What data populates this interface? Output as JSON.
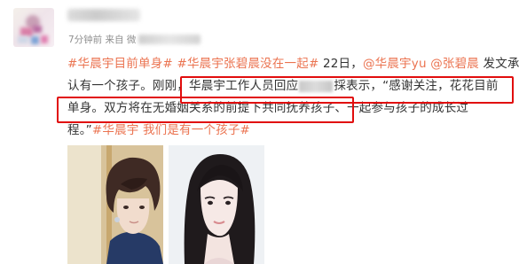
{
  "post": {
    "meta_time": "7分钟前 来自 微",
    "line1": [
      {
        "t": "#华晨宇目前单身#",
        "link": true
      },
      {
        "t": " ",
        "link": false
      },
      {
        "t": "#华晨宇张碧晨没在一起#",
        "link": true
      },
      {
        "t": " 22日，",
        "link": false
      },
      {
        "t": "@华晨宇yu",
        "link": true
      },
      {
        "t": " ",
        "link": false
      },
      {
        "t": "@张碧晨",
        "link": true
      },
      {
        "t": " 发文承",
        "link": false
      }
    ],
    "line2_a": "认有一个孩子。刚刚，华晨宇工作人员回应",
    "line2_b": "採表示，“感谢关注，花花目前",
    "line3": "单身。双方将在无婚姻关系的前提下共同抚养孩子、一起参与孩子的成长过",
    "line4_a": "程。”",
    "line4_link": "#华晨宇 我们是有一个孩子#"
  },
  "colors": {
    "link": "#eb7350",
    "highlight": "#e10d0d",
    "text": "#333333",
    "meta": "#8f8f8f"
  }
}
